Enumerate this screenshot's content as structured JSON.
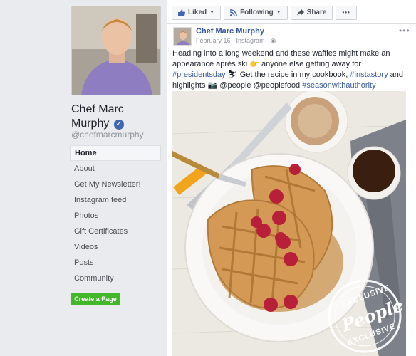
{
  "page": {
    "name": "Chef Marc Murphy",
    "handle": "@chefmarcmurphy",
    "verified_icon": "verified-badge-icon"
  },
  "nav": {
    "items": [
      {
        "label": "Home",
        "active": true
      },
      {
        "label": "About"
      },
      {
        "label": "Get My Newsletter!"
      },
      {
        "label": "Instagram feed"
      },
      {
        "label": "Photos"
      },
      {
        "label": "Gift Certificates"
      },
      {
        "label": "Videos"
      },
      {
        "label": "Posts"
      },
      {
        "label": "Community"
      }
    ],
    "create_page": "Create a Page"
  },
  "actions": {
    "liked": "Liked",
    "following": "Following",
    "share": "Share",
    "more": "•••"
  },
  "post": {
    "author": "Chef Marc Murphy",
    "date": "February 16",
    "source": "Instagram",
    "more": "•••",
    "text_1": "Heading into a long weekend and these waffles might make an appearance après ski",
    "text_2": " anyone else getting away for ",
    "tag_1": "#presidentsday",
    "text_3": " Get the recipe in my cookbook, ",
    "tag_2": "#instastory",
    "text_4": " and highlights ",
    "text_5": " @people @peoplefood ",
    "tag_3": "#seasonwithauthority",
    "watermark_top": "EXCLUSIVE",
    "watermark_brand": "People",
    "watermark_bottom": "EXCLUSIVE"
  },
  "colors": {
    "link": "#365899",
    "green_button": "#42b72a",
    "background": "#e9ebee"
  }
}
